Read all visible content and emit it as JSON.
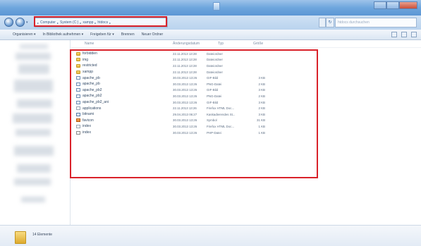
{
  "window": {
    "controls": [
      "minimize",
      "maximize",
      "close"
    ]
  },
  "address_bar": {
    "crumbs": [
      "Computer",
      "System (C:)",
      "xampp",
      "htdocs"
    ],
    "search_placeholder": "htdocs durchsuchen"
  },
  "command_bar": {
    "items": [
      "Organisieren ▾",
      "In Bibliothek aufnehmen ▾",
      "Freigeben für ▾",
      "Brennen",
      "Neuer Ordner"
    ]
  },
  "columns": {
    "name": "Name",
    "date": "Änderungsdatum",
    "type": "Typ",
    "size": "Größe"
  },
  "files": [
    {
      "name": "forbidden",
      "date": "22.11.2013 13:28",
      "type": "Dateiordner",
      "size": "",
      "icon": "folder-icon"
    },
    {
      "name": "img",
      "date": "22.11.2013 13:28",
      "type": "Dateiordner",
      "size": "",
      "icon": "folder-icon"
    },
    {
      "name": "restricted",
      "date": "22.11.2013 13:28",
      "type": "Dateiordner",
      "size": "",
      "icon": "folder-icon"
    },
    {
      "name": "xampp",
      "date": "22.11.2013 13:28",
      "type": "Dateiordner",
      "size": "",
      "icon": "folder-icon"
    },
    {
      "name": "apache_pb",
      "date": "30.03.2013 13:26",
      "type": "GIF-Bild",
      "size": "3 KB",
      "icon": "image-icon"
    },
    {
      "name": "apache_pb",
      "date": "30.03.2013 13:26",
      "type": "PNG-Datei",
      "size": "2 KB",
      "icon": "image-icon"
    },
    {
      "name": "apache_pb2",
      "date": "30.03.2013 13:26",
      "type": "GIF-Bild",
      "size": "3 KB",
      "icon": "image-icon"
    },
    {
      "name": "apache_pb2",
      "date": "30.03.2013 13:26",
      "type": "PNG-Datei",
      "size": "2 KB",
      "icon": "image-icon"
    },
    {
      "name": "apache_pb2_ani",
      "date": "30.03.2013 13:26",
      "type": "GIF-Bild",
      "size": "3 KB",
      "icon": "image-icon"
    },
    {
      "name": "applications",
      "date": "22.11.2013 13:26",
      "type": "Firefox HTML Doc...",
      "size": "2 KB",
      "icon": "html-icon"
    },
    {
      "name": "bitnami",
      "date": "29.04.2013 06:27",
      "type": "Kaskadierendes St...",
      "size": "3 KB",
      "icon": "stylesheet-icon"
    },
    {
      "name": "favicon",
      "date": "30.03.2013 13:26",
      "type": "Symbol",
      "size": "31 KB",
      "icon": "favicon-icon"
    },
    {
      "name": "index",
      "date": "30.03.2013 13:26",
      "type": "Firefox HTML Doc...",
      "size": "1 KB",
      "icon": "html-icon"
    },
    {
      "name": "index",
      "date": "30.03.2013 13:26",
      "type": "PHP-Datei",
      "size": "1 KB",
      "icon": "php-icon"
    }
  ],
  "details_pane": {
    "item_count": "14 Elemente"
  },
  "colors": {
    "highlight": "#d9222a",
    "titlebar": "#6ea6dd",
    "folder": "#e5b53b"
  }
}
